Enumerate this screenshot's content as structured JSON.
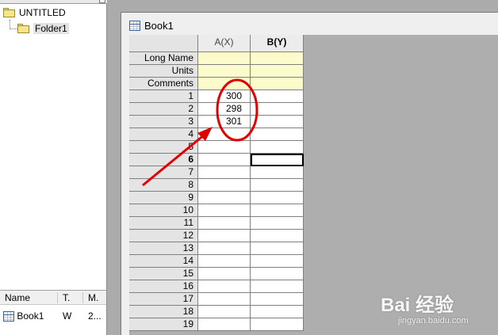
{
  "explorer": {
    "root_label": "UNTITLED",
    "folder_label": "Folder1",
    "columns": [
      "Name",
      "T.",
      "M."
    ],
    "items": [
      {
        "name": "Book1",
        "type": "W",
        "modified": "2..."
      }
    ]
  },
  "workbook": {
    "title": "Book1",
    "columns": [
      {
        "label": "A(X)",
        "bold": false
      },
      {
        "label": "B(Y)",
        "bold": true
      }
    ],
    "label_rows": [
      "Long Name",
      "Units",
      "Comments"
    ],
    "row_numbers": [
      "1",
      "2",
      "3",
      "4",
      "5",
      "6",
      "7",
      "8",
      "9",
      "10",
      "11",
      "12",
      "13",
      "14",
      "15",
      "16",
      "17",
      "18",
      "19"
    ],
    "active_row": "6",
    "column_a_values": [
      "300",
      "298",
      "301"
    ]
  },
  "watermark": {
    "logo": "Bai 经验",
    "url": "jingyan.baidu.com"
  },
  "colors": {
    "annotation_red": "#e00000",
    "label_row_fill": "#fbfbcb",
    "header_fill": "#e4e4e4"
  }
}
